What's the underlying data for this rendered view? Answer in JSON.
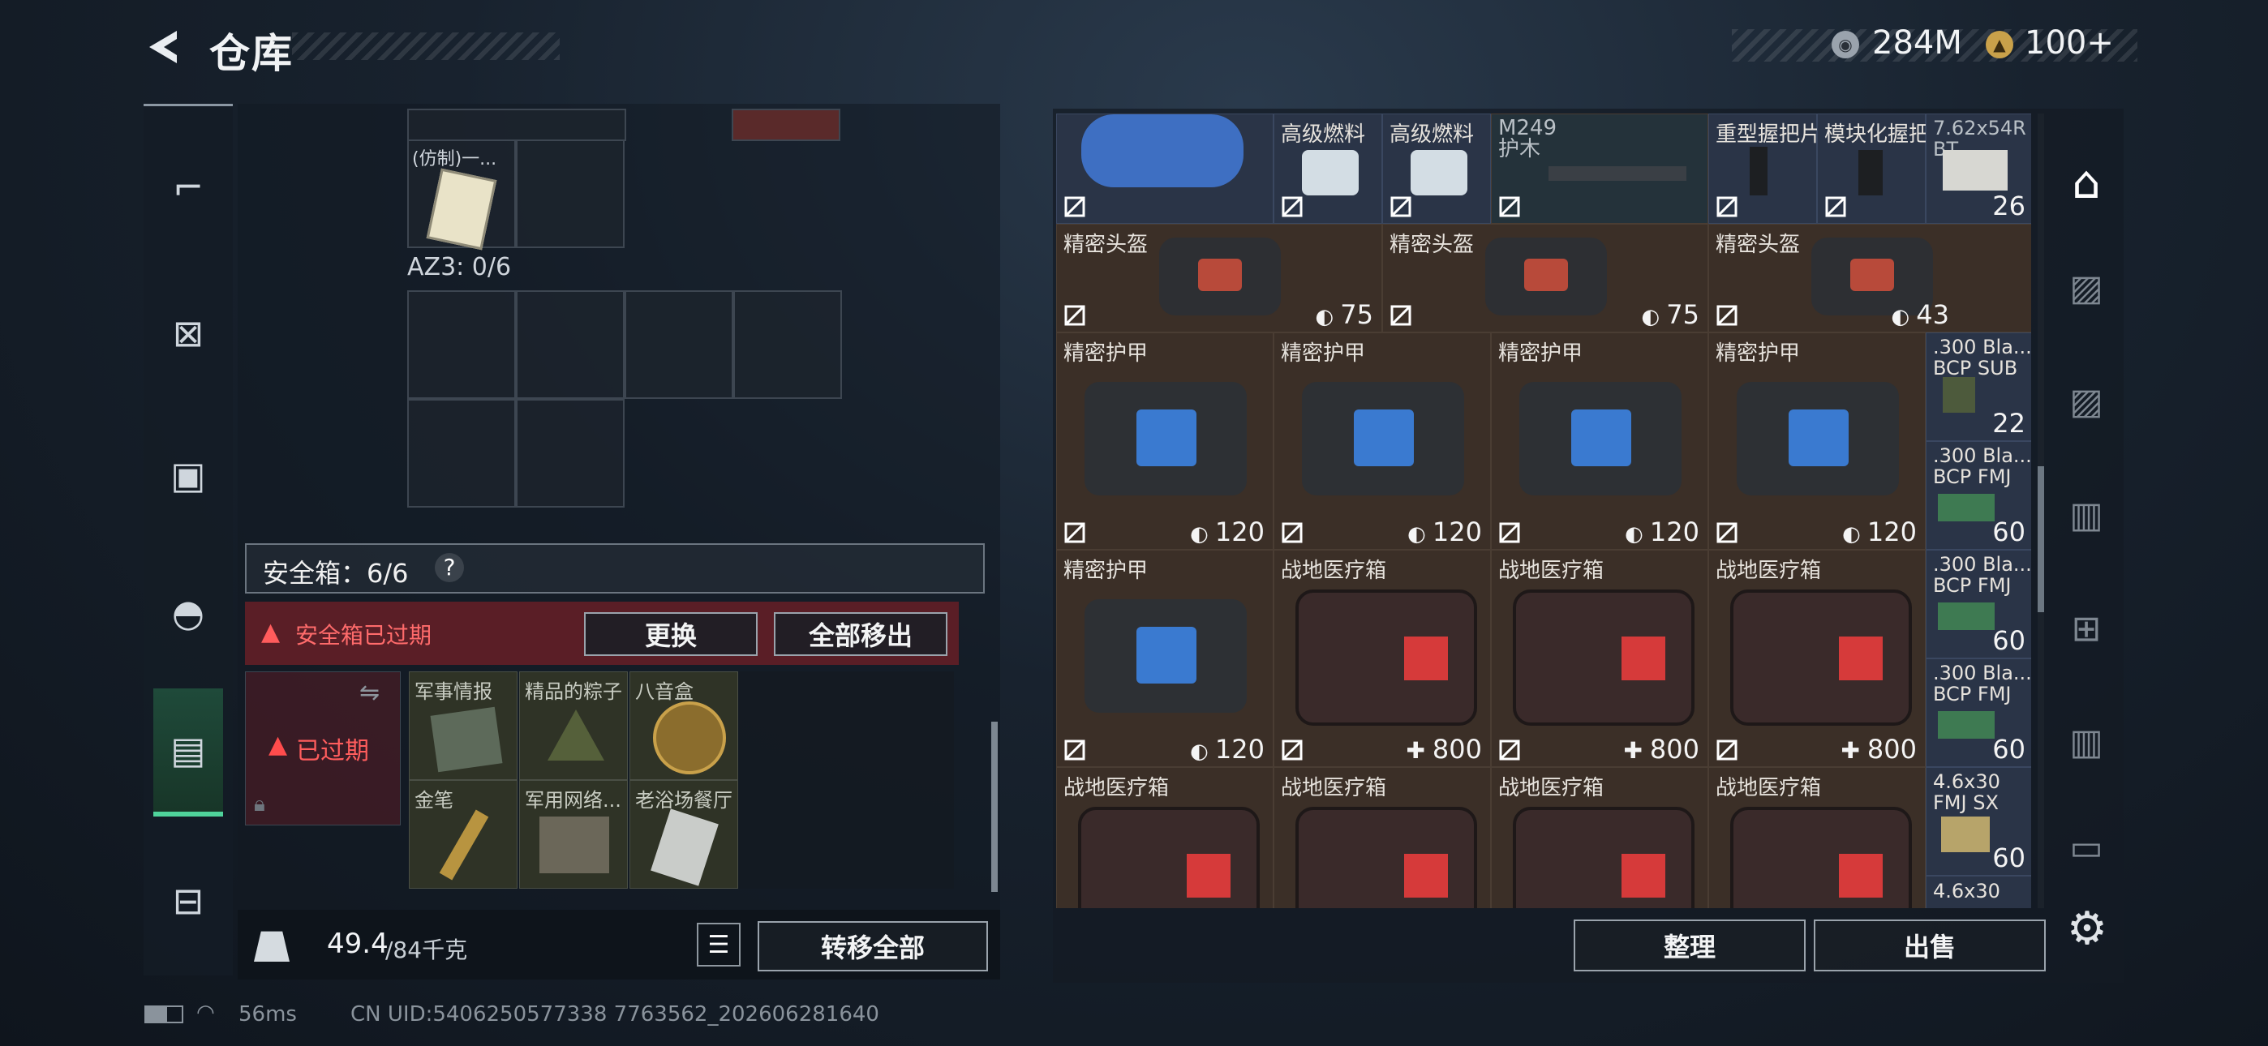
{
  "header": {
    "title": "仓库",
    "currency_silver": "284M",
    "currency_gold": "100+"
  },
  "left_nav": [
    "firearm-icon",
    "vest-icon",
    "backpack-icon",
    "pouch-icon",
    "safebox-icon",
    "briefcase-icon"
  ],
  "left_panel": {
    "top_item": "(仿制)一...",
    "az3_label": "AZ3: 0/6",
    "safebox_label": "安全箱：6/6",
    "safebox_help": "?",
    "expired_message": "安全箱已过期",
    "replace_button": "更换",
    "move_all_out_button": "全部移出",
    "expired_tag": "已过期",
    "safebox_items": [
      {
        "name": "军事情报"
      },
      {
        "name": "精品的粽子"
      },
      {
        "name": "八音盒"
      },
      {
        "name": "金笔"
      },
      {
        "name": "军用网络..."
      },
      {
        "name": "老浴场餐厅"
      }
    ],
    "weight_value": "49.4",
    "weight_max": "/84千克",
    "transfer_all_button": "转移全部"
  },
  "right_panel": {
    "row1": [
      {
        "name": "",
        "value": ""
      },
      {
        "name": "高级燃料",
        "value": ""
      },
      {
        "name": "高级燃料",
        "value": ""
      },
      {
        "name": "M249\n护木",
        "value": ""
      },
      {
        "name": "重型握把片",
        "value": ""
      },
      {
        "name": "模块化握把",
        "value": ""
      },
      {
        "name": "7.62x54R\nBT",
        "value": "26"
      }
    ],
    "helmets": [
      {
        "name": "精密头盔",
        "value": "75"
      },
      {
        "name": "精密头盔",
        "value": "75"
      },
      {
        "name": "精密头盔",
        "value": "43"
      }
    ],
    "armor_row": [
      {
        "name": "精密护甲",
        "value": "120"
      },
      {
        "name": "精密护甲",
        "value": "120"
      },
      {
        "name": "精密护甲",
        "value": "120"
      },
      {
        "name": "精密护甲",
        "value": "120"
      }
    ],
    "med_row": [
      {
        "name": "精密护甲",
        "value": "120"
      },
      {
        "name": "战地医疗箱",
        "value": "800"
      },
      {
        "name": "战地医疗箱",
        "value": "800"
      },
      {
        "name": "战地医疗箱",
        "value": "800"
      }
    ],
    "med_row2": [
      {
        "name": "战地医疗箱"
      },
      {
        "name": "战地医疗箱"
      },
      {
        "name": "战地医疗箱"
      },
      {
        "name": "战地医疗箱"
      }
    ],
    "ammo_column": [
      {
        "name": ".300 Bla...\nBCP SUB",
        "value": "22"
      },
      {
        "name": ".300 Bla...\nBCP FMJ",
        "value": "60"
      },
      {
        "name": ".300 Bla...\nBCP FMJ",
        "value": "60"
      },
      {
        "name": ".300 Bla...\nBCP FMJ",
        "value": "60"
      },
      {
        "name": "4.6x30\nFMJ SX",
        "value": "60"
      },
      {
        "name": "4.6x30",
        "value": ""
      }
    ],
    "sort_button": "整理",
    "sell_button": "出售"
  },
  "status_bar": {
    "ping": "56ms",
    "uid": "CN UID:5406250577338 7763562_202606281640"
  }
}
